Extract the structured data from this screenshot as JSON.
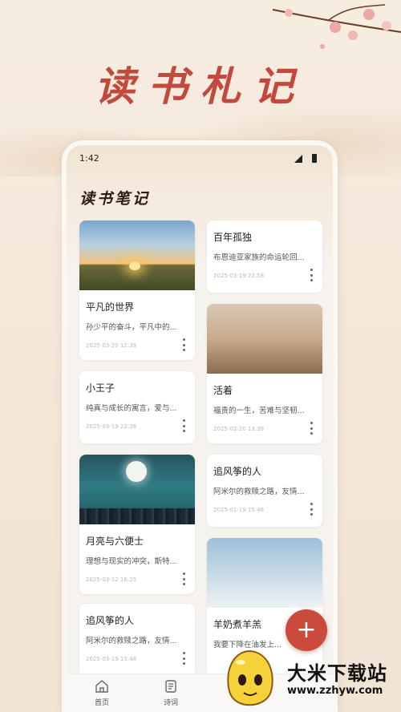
{
  "hero": {
    "title": "读书札记"
  },
  "status_bar": {
    "time": "1:42"
  },
  "page": {
    "title": "读书笔记"
  },
  "notes_left": [
    {
      "title": "平凡的世界",
      "excerpt": "孙少平的奋斗，平凡中的...",
      "date": "2025-03-20 12:39",
      "image": "sunset-field"
    },
    {
      "title": "小王子",
      "excerpt": "纯真与成长的寓言，爱与...",
      "date": "2025-03-19 22:36"
    },
    {
      "title": "月亮与六便士",
      "excerpt": "理想与现实的冲突，斯特...",
      "date": "2025-03-12 16:25",
      "image": "moon-city"
    },
    {
      "title": "追风筝的人",
      "excerpt": "阿米尔的救赎之路，友情...",
      "date": "2025-03-19 15:48"
    }
  ],
  "notes_right": [
    {
      "title": "百年孤独",
      "excerpt": "布恩迪亚家族的命运轮回...",
      "date": "2025-03-19 22:58"
    },
    {
      "title": "活着",
      "excerpt": "福贵的一生，苦难与坚韧...",
      "date": "2025-02-20 13:39",
      "image": "dry-grass"
    },
    {
      "title": "追风筝的人",
      "excerpt": "阿米尔的救赎之路，友情...",
      "date": "2025-01-19 15:48"
    },
    {
      "title": "羊奶煮羊羔",
      "excerpt": "我要下降在油发上...",
      "date": "",
      "image": "cloudy-sky"
    }
  ],
  "fab": {
    "label": "+"
  },
  "bottom_nav": [
    {
      "label": "首页",
      "icon": "home-icon"
    },
    {
      "label": "诗词",
      "icon": "scroll-icon"
    }
  ],
  "watermark": {
    "name": "大米下载站",
    "url": "www.zzhyw.com"
  },
  "colors": {
    "accent": "#cc4a3b",
    "hero_title": "#c24a3c"
  }
}
